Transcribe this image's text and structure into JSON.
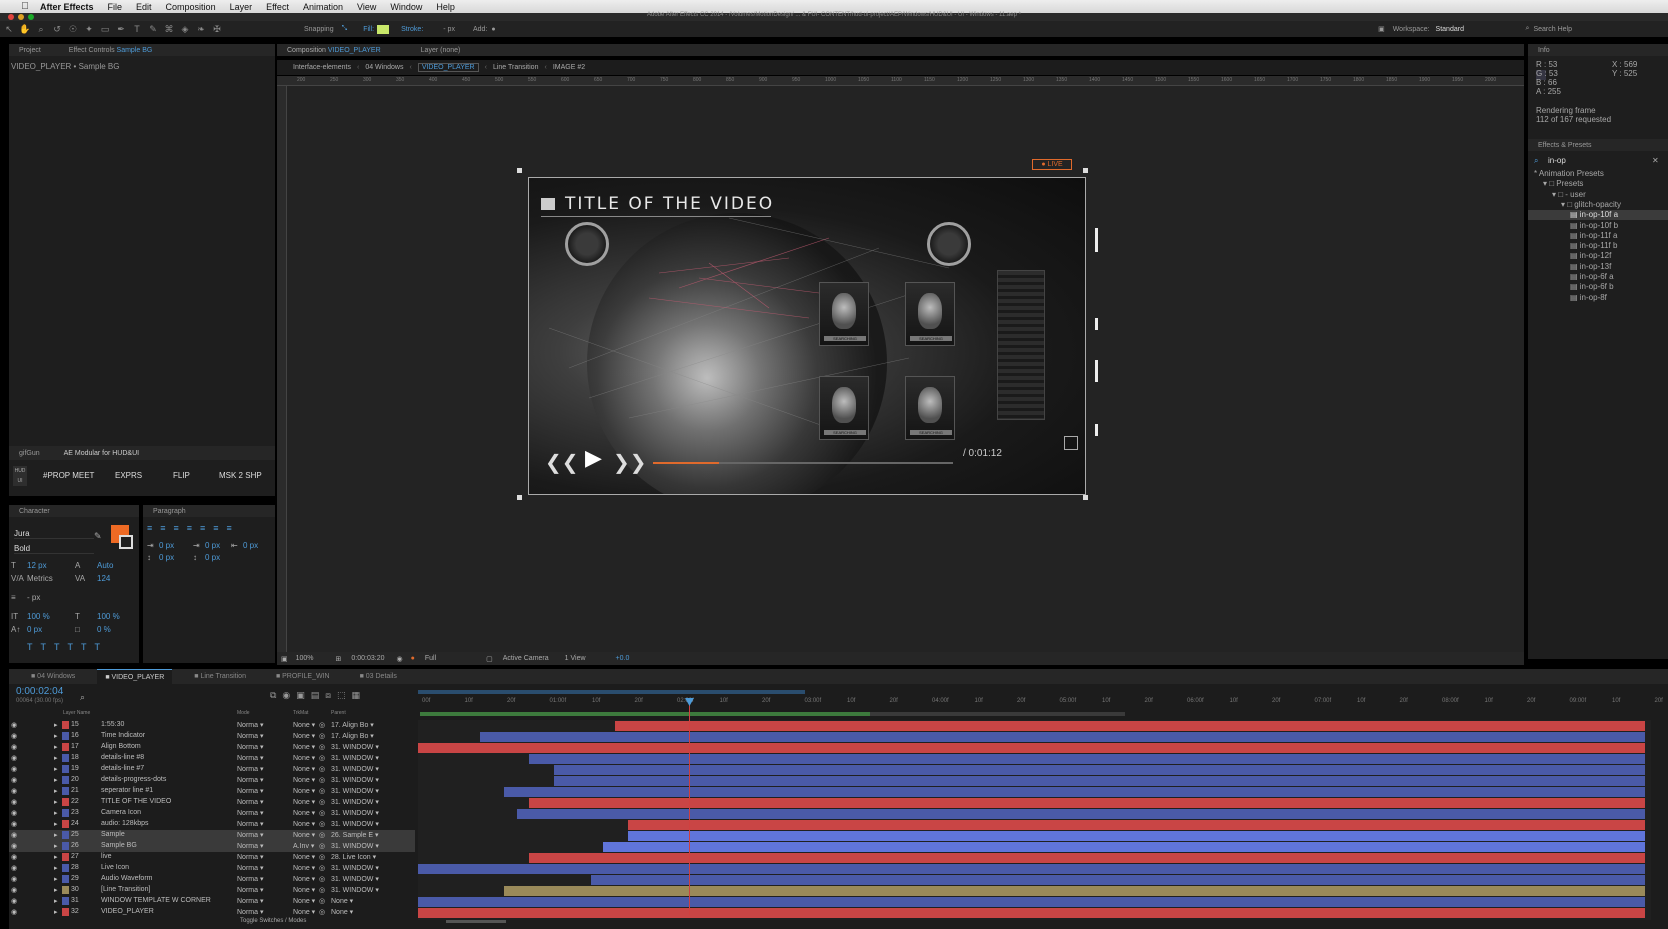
{
  "menubar": {
    "app": "After Effects",
    "items": [
      "File",
      "Edit",
      "Composition",
      "Layer",
      "Effect",
      "Animation",
      "View",
      "Window",
      "Help"
    ]
  },
  "window_title": "Adobe After Effects CC 2014 - /Volumes/MotionDesign/ ... & FUI- CONTENT/hud-ui-project/AEP/Windows/HUD&UI - UI - Windows - 11.aep *",
  "toolbar": {
    "snapping": "Snapping",
    "fill": "Fill:",
    "stroke": "Stroke:",
    "stroke_width": "- px",
    "add": "Add:",
    "workspace_label": "Workspace:",
    "workspace_value": "Standard",
    "search_help": "Search Help"
  },
  "project_panel": {
    "tab_project": "Project",
    "tab_effect_controls": "Effect Controls",
    "effect_controls_target": "Sample BG",
    "subtitle": "VIDEO_PLAYER • Sample BG"
  },
  "gifgun": {
    "tab": "gifGun",
    "tab2": "AE Modular for HUD&UI",
    "buttons": [
      "#PROP MEET",
      "EXPRS",
      "FLIP",
      "MSK 2 SHP"
    ]
  },
  "character": {
    "title": "Character",
    "font": "Jura",
    "style": "Bold",
    "size": "12 px",
    "leading": "Auto",
    "kerning": "Metrics",
    "tracking": "124",
    "stroke": "- px",
    "v_scale": "100 %",
    "h_scale": "100 %",
    "baseline": "0 px",
    "tsume": "0 %",
    "fill_color": "#ee6a24"
  },
  "paragraph": {
    "title": "Paragraph",
    "indent_left": "0 px",
    "indent_first": "0 px",
    "indent_right": "0 px",
    "space_before": "0 px",
    "space_after": "0 px"
  },
  "composition": {
    "tab_label": "Composition",
    "tab_name": "VIDEO_PLAYER",
    "layer_tab": "Layer (none)",
    "breadcrumbs": [
      "Interface-elements",
      "04 Windows",
      "VIDEO_PLAYER",
      "Line Transition",
      "IMAGE #2"
    ],
    "ruler_ticks": [
      "200",
      "250",
      "300",
      "350",
      "400",
      "450",
      "500",
      "550",
      "600",
      "650",
      "700",
      "750",
      "800",
      "850",
      "900",
      "950",
      "1000",
      "1050",
      "1100",
      "1150",
      "1200",
      "1250",
      "1300",
      "1350",
      "1400",
      "1450",
      "1500",
      "1550",
      "1600",
      "1650",
      "1700",
      "1750",
      "1800",
      "1850",
      "1900",
      "1950",
      "2000"
    ],
    "zoom": "100%",
    "timecode": "0:00:03:20",
    "resolution": "Full",
    "camera": "Active Camera",
    "views": "1 View",
    "exposure": "+0.0"
  },
  "video": {
    "title": "TITLE OF THE VIDEO",
    "live": "LIVE",
    "duration": "/ 0:01:12",
    "progress": 0.22,
    "card_labels": [
      "SEARCHING",
      "SEARCHING",
      "SEARCHING",
      "SEARCHING"
    ]
  },
  "info": {
    "title": "Info",
    "r": "R : 53",
    "g": "G : 53",
    "b": "B : 66",
    "a": "A : 255",
    "x": "X : 569",
    "y": "Y : 525",
    "rendering": "Rendering frame",
    "frames": "112 of 167 requested"
  },
  "effects_presets": {
    "title": "Effects & Presets",
    "search": "in-op",
    "tree": [
      {
        "label": "* Animation Presets",
        "depth": 0
      },
      {
        "label": "Presets",
        "depth": 1
      },
      {
        "label": "- user",
        "depth": 2
      },
      {
        "label": "glitch-opacity",
        "depth": 3
      },
      {
        "label": "in-op-10f a",
        "depth": 4,
        "selected": true
      },
      {
        "label": "in-op-10f b",
        "depth": 4
      },
      {
        "label": "in-op-11f a",
        "depth": 4
      },
      {
        "label": "in-op-11f b",
        "depth": 4
      },
      {
        "label": "in-op-12f",
        "depth": 4
      },
      {
        "label": "in-op-13f",
        "depth": 4
      },
      {
        "label": "in-op-6f a",
        "depth": 4
      },
      {
        "label": "in-op-6f b",
        "depth": 4
      },
      {
        "label": "in-op-8f",
        "depth": 4
      }
    ]
  },
  "timeline": {
    "tabs": [
      "04 Windows",
      "VIDEO_PLAYER",
      "Line Transition",
      "PROFILE_WIN",
      "03 Details"
    ],
    "active_tab": 1,
    "timecode": "0:00:02:04",
    "frame_info": "00064 (30.00 fps)",
    "col_layer_name": "Layer Name",
    "col_mode": "Mode",
    "col_trkmat": "TrkMat",
    "col_parent": "Parent",
    "ruler_labels": [
      "00f",
      "10f",
      "20f",
      "01:00f",
      "10f",
      "20f",
      "02:00f",
      "10f",
      "20f",
      "03:00f",
      "10f",
      "20f",
      "04:00f",
      "10f",
      "20f",
      "05:00f",
      "10f",
      "20f",
      "06:00f",
      "10f",
      "20f",
      "07:00f",
      "10f",
      "20f",
      "08:00f",
      "10f",
      "20f",
      "09:00f",
      "10f",
      "20f"
    ],
    "toggle_label": "Toggle Switches / Modes",
    "layers": [
      {
        "num": "15",
        "name": "1:55:30",
        "mode": "Norma",
        "trk": "None",
        "parent": "17. Align Bo"
      },
      {
        "num": "16",
        "name": "Time Indicator",
        "mode": "Norma",
        "trk": "None",
        "parent": "17. Align Bo"
      },
      {
        "num": "17",
        "name": "Align Bottom",
        "mode": "Norma",
        "trk": "None",
        "parent": "31. WINDOW"
      },
      {
        "num": "18",
        "name": "details-line #8",
        "mode": "Norma",
        "trk": "None",
        "parent": "31. WINDOW"
      },
      {
        "num": "19",
        "name": "details-line #7",
        "mode": "Norma",
        "trk": "None",
        "parent": "31. WINDOW"
      },
      {
        "num": "20",
        "name": "details-progress-dots",
        "mode": "Norma",
        "trk": "None",
        "parent": "31. WINDOW"
      },
      {
        "num": "21",
        "name": "seperator line #1",
        "mode": "Norma",
        "trk": "None",
        "parent": "31. WINDOW"
      },
      {
        "num": "22",
        "name": "TITLE OF THE VIDEO",
        "mode": "Norma",
        "trk": "None",
        "parent": "31. WINDOW"
      },
      {
        "num": "23",
        "name": "Camera Icon",
        "mode": "Norma",
        "trk": "None",
        "parent": "31. WINDOW"
      },
      {
        "num": "24",
        "name": "audio: 128kbps",
        "mode": "Norma",
        "trk": "None",
        "parent": "31. WINDOW"
      },
      {
        "num": "25",
        "name": "Sample",
        "mode": "Norma",
        "trk": "None",
        "parent": "26. Sample E"
      },
      {
        "num": "26",
        "name": "Sample BG",
        "mode": "Norma",
        "trk": "A.Inv",
        "parent": "31. WINDOW"
      },
      {
        "num": "27",
        "name": "live",
        "mode": "Norma",
        "trk": "None",
        "parent": "28. Live Icon"
      },
      {
        "num": "28",
        "name": "Live Icon",
        "mode": "Norma",
        "trk": "None",
        "parent": "31. WINDOW"
      },
      {
        "num": "29",
        "name": "Audio Waveform",
        "mode": "Norma",
        "trk": "None",
        "parent": "31. WINDOW"
      },
      {
        "num": "30",
        "name": "[Line Transition]",
        "mode": "Norma",
        "trk": "None",
        "parent": "31. WINDOW"
      },
      {
        "num": "31",
        "name": "WINDOW TEMPLATE W CORNER",
        "mode": "Norma",
        "trk": "None",
        "parent": "None"
      },
      {
        "num": "32",
        "name": "VIDEO_PLAYER",
        "mode": "Norma",
        "trk": "None",
        "parent": "None"
      }
    ],
    "layer_colors": [
      "#c94545",
      "#4a5aa8",
      "#c94545",
      "#4a5aa8",
      "#4a5aa8",
      "#4a5aa8",
      "#4a5aa8",
      "#c94545",
      "#4a5aa8",
      "#c94545",
      "#4a5aa8",
      "#4a5aa8",
      "#c94545",
      "#4a5aa8",
      "#4a5aa8",
      "#9a8a5a",
      "#4a5aa8",
      "#c94545"
    ],
    "selected_layers": [
      10,
      11
    ]
  }
}
